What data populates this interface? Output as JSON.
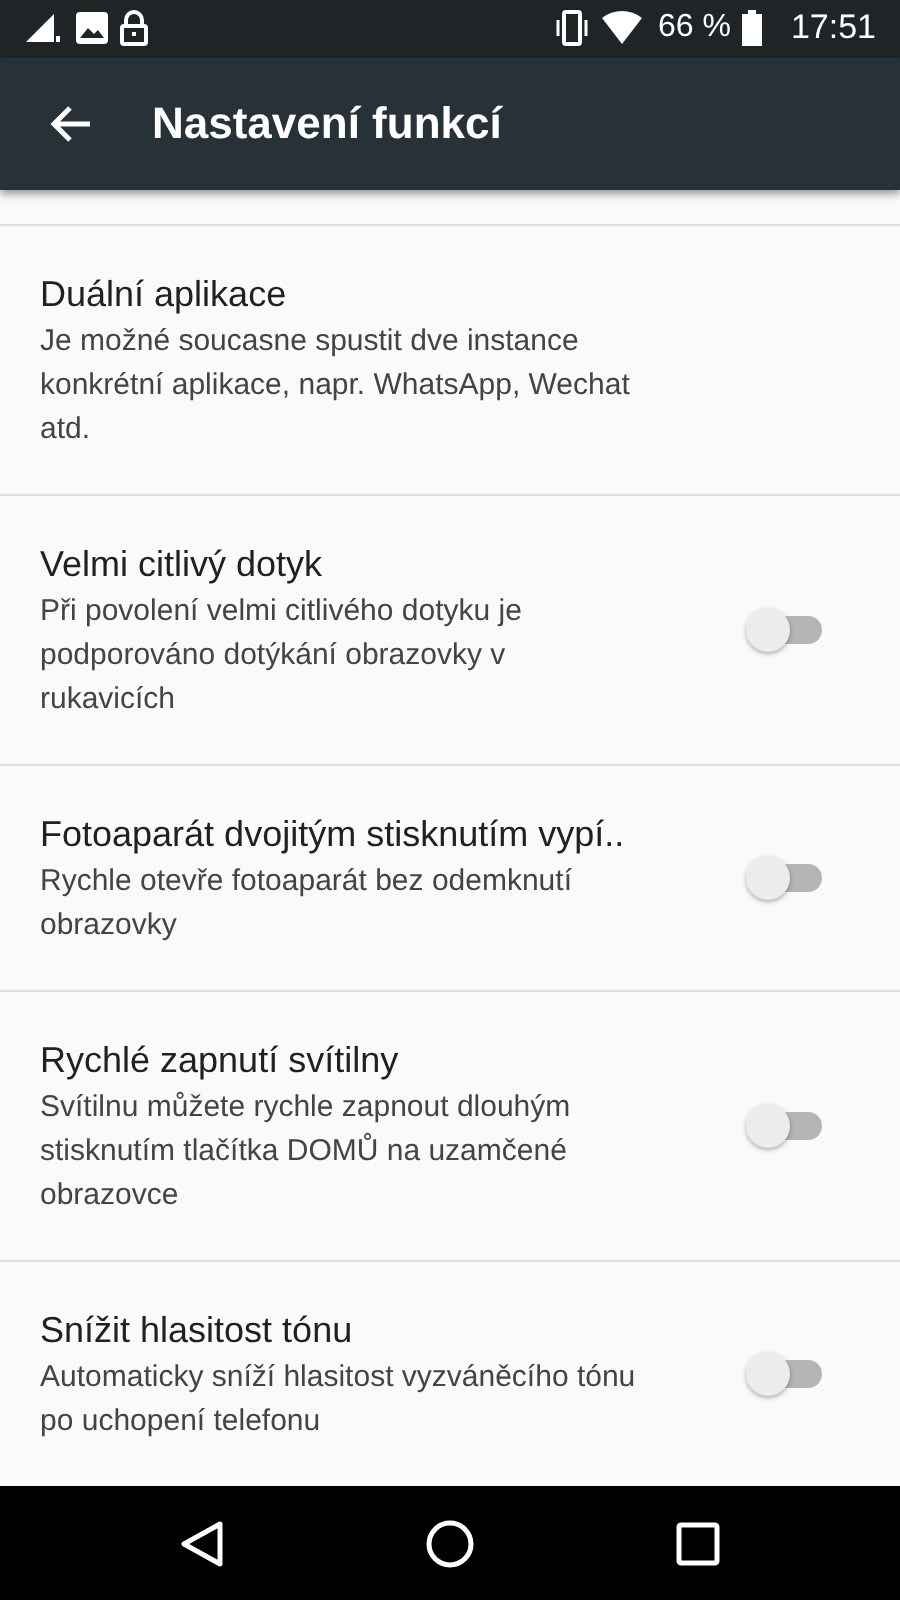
{
  "status_bar": {
    "battery_text": "66 %",
    "time": "17:51"
  },
  "app_bar": {
    "title": "Nastavení funkcí"
  },
  "settings": [
    {
      "kind": "text",
      "title": "Duální aplikace",
      "summary": "Je možné soucasne spustit dve instance konkrétní aplikace, napr. WhatsApp, Wechat atd."
    },
    {
      "kind": "switch",
      "title": "Velmi citlivý dotyk",
      "summary": "Při povolení velmi citlivého dotyku je podporováno dotýkání obrazovky v rukavicích",
      "on": false
    },
    {
      "kind": "switch",
      "title": "Fotoaparát dvojitým stisknutím vypí..",
      "summary": "Rychle otevře fotoaparát bez odemknutí obrazovky",
      "on": false
    },
    {
      "kind": "switch",
      "title": "Rychlé zapnutí svítilny",
      "summary": "Svítilnu můžete rychle zapnout dlouhým stisknutím tlačítka DOMŮ na uzamčené obrazovce",
      "on": false
    },
    {
      "kind": "switch",
      "title": "Snížit hlasitost tónu",
      "summary": "Automaticky sníží hlasitost vyzváněcího tónu po uchopení telefonu",
      "on": false
    }
  ]
}
